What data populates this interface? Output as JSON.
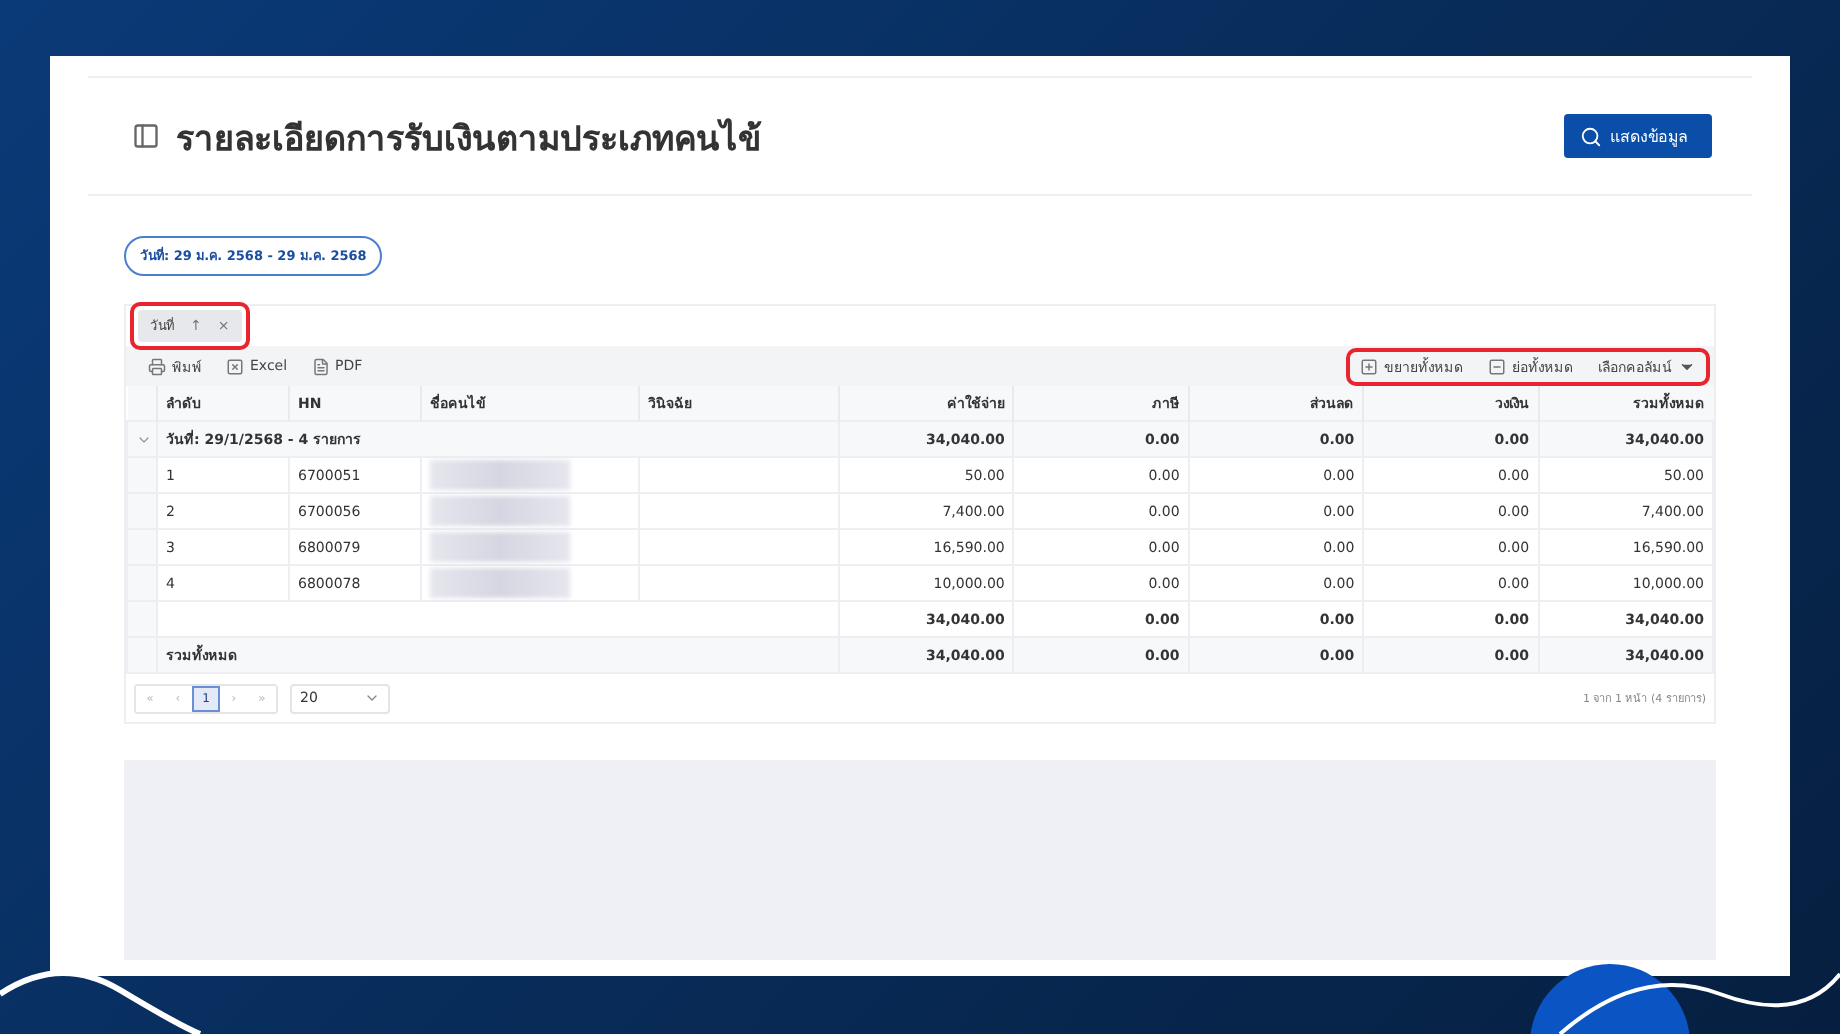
{
  "header": {
    "title": "รายละเอียดการรับเงินตามประเภทคนไข้",
    "button": "แสดงข้อมูล"
  },
  "filter_chip": "วันที่: 29 ม.ค. 2568 - 29 ม.ค. 2568",
  "group_by": {
    "label": "วันที่",
    "sort": "↑",
    "remove": "×",
    "highlighted": true
  },
  "toolbar": {
    "left": [
      {
        "kind": "print",
        "label": "พิมพ์"
      },
      {
        "kind": "excel",
        "label": "Excel"
      },
      {
        "kind": "pdf",
        "label": "PDF"
      }
    ],
    "right": [
      {
        "kind": "expand",
        "label": "ขยายทั้งหมด"
      },
      {
        "kind": "collapse",
        "label": "ย่อทั้งหมด"
      },
      {
        "kind": "columns",
        "label": "เลือกคอลัมน์"
      }
    ],
    "right_highlighted": true
  },
  "table": {
    "columns": [
      "ลำดับ",
      "HN",
      "ชื่อคนไข้",
      "วินิจฉัย",
      "ค่าใช้จ่าย",
      "ภาษี",
      "ส่วนลด",
      "วงเงิน",
      "รวมทั้งหมด"
    ],
    "group": {
      "label": "วันที่: 29/1/2568 - 4 รายการ",
      "expanded": true,
      "totals": [
        "34,040.00",
        "0.00",
        "0.00",
        "0.00",
        "34,040.00"
      ]
    },
    "rows": [
      {
        "no": "1",
        "hn": "6700051",
        "name_blurred": true,
        "values": [
          "50.00",
          "0.00",
          "0.00",
          "0.00",
          "50.00"
        ]
      },
      {
        "no": "2",
        "hn": "6700056",
        "name_blurred": true,
        "values": [
          "7,400.00",
          "0.00",
          "0.00",
          "0.00",
          "7,400.00"
        ]
      },
      {
        "no": "3",
        "hn": "6800079",
        "name_blurred": true,
        "values": [
          "16,590.00",
          "0.00",
          "0.00",
          "0.00",
          "16,590.00"
        ]
      },
      {
        "no": "4",
        "hn": "6800078",
        "name_blurred": true,
        "values": [
          "10,000.00",
          "0.00",
          "0.00",
          "0.00",
          "10,000.00"
        ]
      }
    ],
    "subtotal": [
      "34,040.00",
      "0.00",
      "0.00",
      "0.00",
      "34,040.00"
    ],
    "total": {
      "label": "รวมทั้งหมด",
      "values": [
        "34,040.00",
        "0.00",
        "0.00",
        "0.00",
        "34,040.00"
      ]
    }
  },
  "pager": {
    "buttons": [
      {
        "label": "«",
        "selected": false
      },
      {
        "label": "‹",
        "selected": false
      },
      {
        "label": "1",
        "selected": true
      },
      {
        "label": "›",
        "selected": false
      },
      {
        "label": "»",
        "selected": false
      }
    ],
    "page_size": "20",
    "summary": "1 จาก 1 หน้า (4 รายการ)"
  }
}
